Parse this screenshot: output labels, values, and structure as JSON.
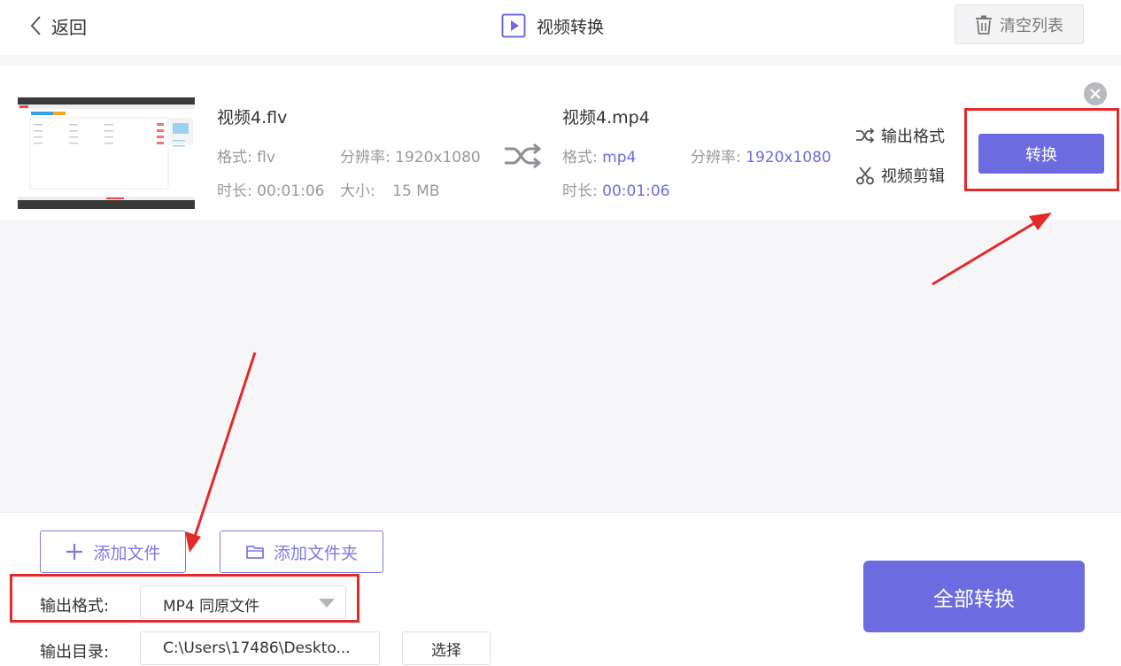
{
  "header": {
    "back_label": "返回",
    "title": "视频转换",
    "clear_label": "清空列表"
  },
  "file": {
    "source": {
      "name": "视频4.flv",
      "format_label": "格式:",
      "format_value": "flv",
      "resolution_label": "分辨率:",
      "resolution_value": "1920x1080",
      "duration_label": "时长:",
      "duration_value": "00:01:06",
      "size_label": "大小:",
      "size_value": "15 MB"
    },
    "target": {
      "name": "视频4.mp4",
      "format_label": "格式:",
      "format_value": "mp4",
      "resolution_label": "分辨率:",
      "resolution_value": "1920x1080",
      "duration_label": "时长:",
      "duration_value": "00:01:06"
    },
    "output_format_option": "输出格式",
    "video_cut_option": "视频剪辑",
    "convert_label": "转换"
  },
  "bottom": {
    "add_file_label": "添加文件",
    "add_folder_label": "添加文件夹",
    "output_format_label": "输出格式:",
    "output_format_value": "MP4 同原文件",
    "output_dir_label": "输出目录:",
    "output_dir_value": "C:\\Users\\17486\\Deskto...",
    "choose_label": "选择",
    "convert_all_label": "全部转换"
  },
  "colors": {
    "accent": "#6c6ce0",
    "highlight": "#e32a2a"
  }
}
